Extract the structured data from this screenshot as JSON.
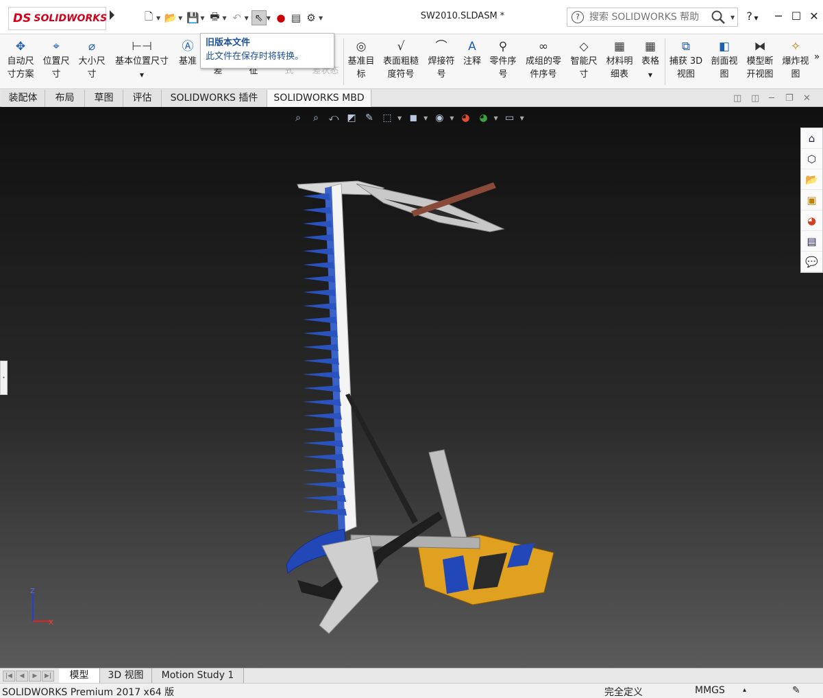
{
  "app": {
    "logo_mark": "DS",
    "logo_text": "SOLIDWORKS",
    "document_title": "SW2010.SLDASM *",
    "search_placeholder": "搜索 SOLIDWORKS 帮助",
    "help_label": "?",
    "quick_access": [
      "new-doc-icon",
      "open-folder-icon",
      "save-icon",
      "print-icon",
      "undo-icon",
      "select-pointer-icon",
      "rebuild-traffic-light-icon",
      "file-properties-icon",
      "options-gear-icon"
    ]
  },
  "tooltip": {
    "title": "旧版本文件",
    "text": "此文件在保存时将转换。"
  },
  "ribbon": {
    "items": [
      {
        "l1": "自动尺",
        "l2": "寸方案"
      },
      {
        "l1": "位置尺",
        "l2": "寸"
      },
      {
        "l1": "大小尺",
        "l2": "寸"
      },
      {
        "l1": "基本位置尺寸",
        "l2": ""
      },
      {
        "l1": "基准",
        "l2": ""
      },
      {
        "l1": "差",
        "l2": ""
      },
      {
        "l1": "征",
        "l2": ""
      },
      {
        "l1": "式",
        "l2": ""
      },
      {
        "l1": "差状态",
        "l2": ""
      },
      {
        "l1": "基准目",
        "l2": "标"
      },
      {
        "l1": "表面粗糙",
        "l2": "度符号"
      },
      {
        "l1": "焊接符",
        "l2": "号"
      },
      {
        "l1": "注释",
        "l2": ""
      },
      {
        "l1": "零件序",
        "l2": "号"
      },
      {
        "l1": "成组的零",
        "l2": "件序号"
      },
      {
        "l1": "智能尺",
        "l2": "寸"
      },
      {
        "l1": "材料明",
        "l2": "细表"
      },
      {
        "l1": "表格",
        "l2": ""
      },
      {
        "l1": "捕获 3D",
        "l2": "视图"
      },
      {
        "l1": "剖面视",
        "l2": "图"
      },
      {
        "l1": "模型断",
        "l2": "开视图"
      },
      {
        "l1": "爆炸视",
        "l2": "图"
      }
    ],
    "overflow": "»"
  },
  "tabs": [
    "装配体",
    "布局",
    "草图",
    "评估",
    "SOLIDWORKS 插件",
    "SOLIDWORKS MBD"
  ],
  "axes": {
    "z": "Z",
    "x": "X"
  },
  "bottom_tabs": [
    "模型",
    "3D 视图",
    "Motion Study 1"
  ],
  "status": {
    "product": "SOLIDWORKS Premium 2017 x64 版",
    "definition": "完全定义",
    "units": "MMGS",
    "units_arrow": "▴"
  },
  "colors": {
    "blue_part": "#2248b8",
    "orange_part": "#e0a020",
    "silver_part": "#c8c8c8",
    "rod_part": "#8a4a3a"
  }
}
